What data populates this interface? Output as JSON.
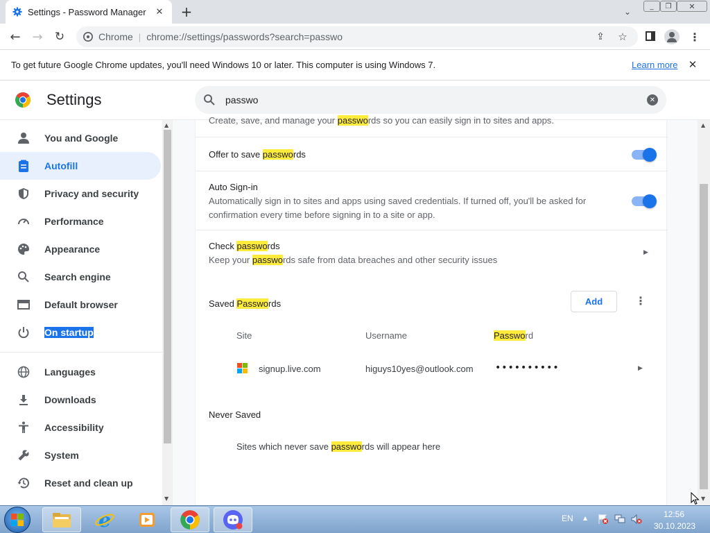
{
  "browser": {
    "tab_title": "Settings - Password Manager",
    "site_label": "Chrome",
    "url": "chrome://settings/passwords?search=passwo"
  },
  "infobar": {
    "message": "To get future Google Chrome updates, you'll need Windows 10 or later. This computer is using Windows 7.",
    "learn_more": "Learn more"
  },
  "header": {
    "title": "Settings",
    "search_value": "passwo"
  },
  "sidebar": {
    "items": [
      {
        "label": "You and Google"
      },
      {
        "label": "Autofill"
      },
      {
        "label": "Privacy and security"
      },
      {
        "label": "Performance"
      },
      {
        "label": "Appearance"
      },
      {
        "label": "Search engine"
      },
      {
        "label": "Default browser"
      },
      {
        "label": "On startup"
      },
      {
        "label": "Languages"
      },
      {
        "label": "Downloads"
      },
      {
        "label": "Accessibility"
      },
      {
        "label": "System"
      },
      {
        "label": "Reset and clean up"
      }
    ]
  },
  "main": {
    "intro": {
      "pre": "Create, save, and manage your ",
      "hl": "passwo",
      "post": "rds so you can easily sign in to sites and apps."
    },
    "offer": {
      "pre": "Offer to save ",
      "hl": "passwo",
      "post": "rds",
      "enabled": true
    },
    "autosignin": {
      "title": "Auto Sign-in",
      "desc1": "Automatically sign in to sites and apps using saved credentials. If turned off, you'll be asked for",
      "desc2": "confirmation every time before signing in to a site or app.",
      "enabled": true
    },
    "check": {
      "pre": "Check ",
      "hl": "passwo",
      "post": "rds",
      "desc_pre": "Keep your ",
      "desc_hl": "passwo",
      "desc_post": "rds safe from data breaches and other security issues"
    },
    "saved": {
      "pre": "Saved ",
      "hl": "Passwo",
      "post": "rds",
      "add_label": "Add"
    },
    "table": {
      "col_site": "Site",
      "col_user": "Username",
      "col_pass_hl": "Passwo",
      "col_pass_post": "rd",
      "rows": [
        {
          "site": "signup.live.com",
          "username": "higuys10yes@outlook.com",
          "password": "••••••••••"
        }
      ]
    },
    "never": {
      "title": "Never Saved",
      "pre": "Sites which never save ",
      "hl": "passwo",
      "post": "rds will appear here"
    }
  },
  "taskbar": {
    "lang": "EN",
    "time": "12:56",
    "date": "30.10.2023"
  },
  "colors": {
    "accent": "#1a73e8",
    "highlight": "#ffeb3b",
    "active_nav_bg": "#e8f0fe"
  }
}
